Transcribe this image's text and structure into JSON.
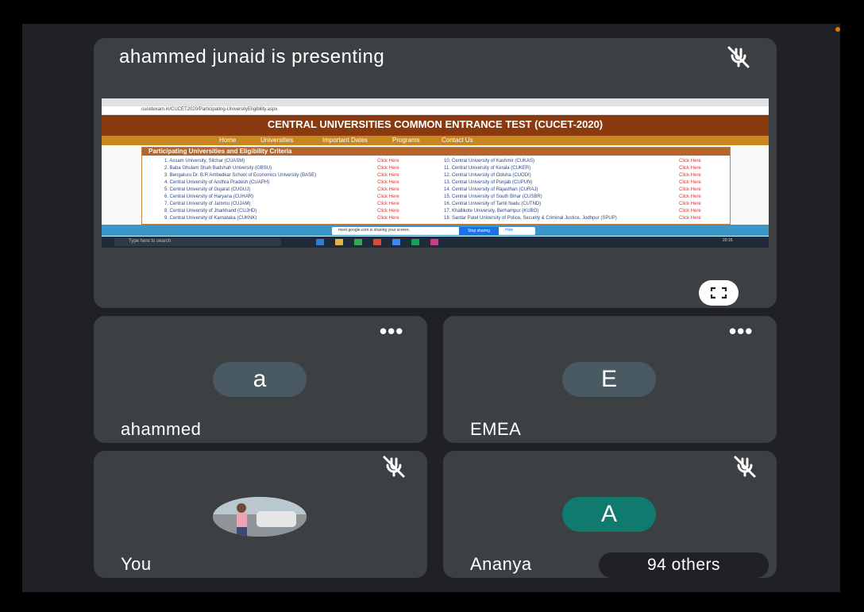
{
  "presenter": {
    "banner": "ahammed junaid is presenting",
    "shared_screen": {
      "address_bar": "cucetexam.in/CUCET2020/Participating-UniversityEligibility.aspx",
      "site_title": "CENTRAL UNIVERSITIES COMMON ENTRANCE TEST (CUCET-2020)",
      "nav": [
        "Home",
        "Universities",
        "Important Dates",
        "Programs",
        "Contact Us"
      ],
      "panel_title": "Participating Universities and Eligibility Criteria",
      "left_list": [
        "1. Assam University, Silchar (CUASM)",
        "2. Baba Ghulam Shah Badshah University (GBSU)",
        "3. Bengaluru Dr. B.R Ambedkar School of Economics University (BASE)",
        "4. Central University of Andhra Pradesh (CUAPH)",
        "5. Central University of Gujarat (CUGUJ)",
        "6. Central University of Haryana (CUHAR)",
        "7. Central University of Jammu (CUJAM)",
        "8. Central University of Jharkhand (CUJHD)",
        "9. Central University of Karnataka (CUKNK)"
      ],
      "right_list": [
        "10. Central University of Kashmir (CUKAS)",
        "11. Central University of Kerala (CUKER)",
        "12. Central University of Odisha (CUODI)",
        "13. Central University of Punjab (CUPUN)",
        "14. Central University of Rajasthan (CURAJ)",
        "15. Central University of South Bihar (CUSBR)",
        "16. Central University of Tamil Nadu (CUTND)",
        "17. Khallikote University, Berhampur (KUBO)",
        "18. Sardar Patel University of Police, Security & Criminal Justice, Jodhpur (SPUP)"
      ],
      "click_label": "Click Here",
      "share_notice": "meet.google.com is sharing your screen.",
      "stop_sharing": "Stop sharing",
      "hide": "Hide",
      "taskbar_search": "Type here to search",
      "taskbar_time": "20:15"
    }
  },
  "participants": [
    {
      "name": "ahammed",
      "initial": "a",
      "avatar_color": "#4a5a63"
    },
    {
      "name": "EMEA",
      "initial": "E",
      "avatar_color": "#4a5a63"
    },
    {
      "name": "You"
    },
    {
      "name": "Ananya",
      "initial": "A",
      "avatar_color": "#0f7a6d"
    }
  ],
  "others_label": "94 others",
  "icons": {
    "mic": "mic-off-icon",
    "more": "more-options-icon",
    "fullscreen": "fullscreen-icon"
  }
}
